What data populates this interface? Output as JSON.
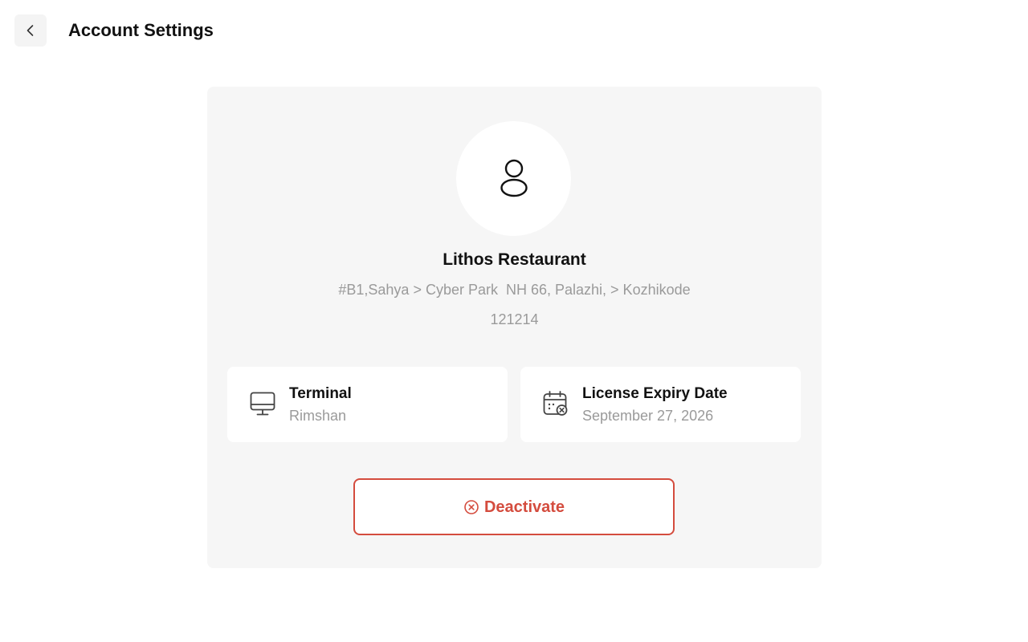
{
  "header": {
    "title": "Account Settings",
    "back_icon": "chevron-left-icon"
  },
  "profile": {
    "avatar_icon": "user-icon",
    "name": "Lithos Restaurant",
    "address": "#B1,Sahya > Cyber Park  NH 66, Palazhi, > Kozhikode",
    "pincode": "121214"
  },
  "terminal": {
    "icon": "monitor-icon",
    "title": "Terminal",
    "value": "Rimshan"
  },
  "license": {
    "icon": "calendar-icon",
    "title": "License Expiry Date",
    "value": "September 27, 2026"
  },
  "actions": {
    "deactivate_label": "Deactivate",
    "deactivate_icon": "x-circle-icon"
  },
  "colors": {
    "danger": "#d44c3e",
    "card_background": "#f6f6f6",
    "muted_text": "#9a9a9a"
  }
}
